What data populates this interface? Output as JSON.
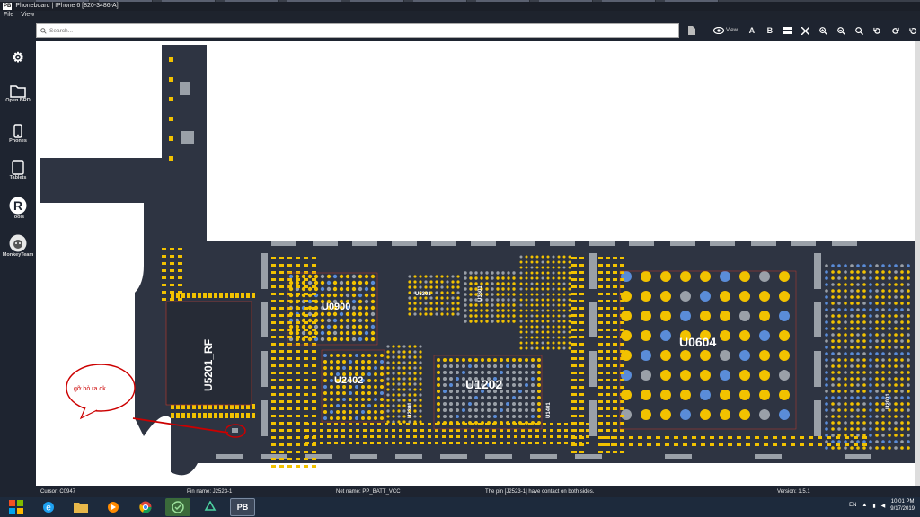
{
  "window": {
    "app_logo": "PB",
    "title": "Phoneboard | IPhone 6 [820-3486-A]"
  },
  "menu": [
    "File",
    "View"
  ],
  "search": {
    "placeholder": "Search..."
  },
  "toolbar": {
    "view_label": "View",
    "font_a": "A",
    "font_b": "B"
  },
  "sidebar": {
    "items": [
      {
        "label": "",
        "icon": "gear-icon"
      },
      {
        "label": "Open BRD",
        "icon": "folder-icon"
      },
      {
        "label": "Phones",
        "icon": "phone-icon"
      },
      {
        "label": "Tablets",
        "icon": "tablet-icon"
      },
      {
        "label": "Tools",
        "icon": "tools-icon"
      },
      {
        "label": "MonkeyTeam",
        "icon": "monkey-icon"
      }
    ]
  },
  "board": {
    "chips": [
      "U0900",
      "U2402",
      "U1202",
      "U0604",
      "U5201_RF"
    ],
    "annotation": "gỡ bỏ ra ok"
  },
  "status": {
    "cursor": "Cursor: C0947",
    "pin": "Pin name: J2523-1",
    "net": "Net name: PP_BATT_VCC",
    "message": "The pin [J2523-1] have contact on both sides.",
    "version": "Version: 1.5.1"
  },
  "taskbar": {
    "apps": [
      "start-icon",
      "ie-icon",
      "folder-icon",
      "media-icon",
      "chrome-icon",
      "green-app-icon",
      "recycle-icon",
      "phoneboard-icon"
    ],
    "active_app_label": "PB",
    "language": "EN",
    "time": "10:01 PM",
    "date": "9/17/2019"
  },
  "colors": {
    "board": "#2e3442",
    "pad_yellow": "#f2c200",
    "pad_gray": "#9aa0a8",
    "pad_blue": "#5a8cd8",
    "annotation": "#cc0000"
  }
}
